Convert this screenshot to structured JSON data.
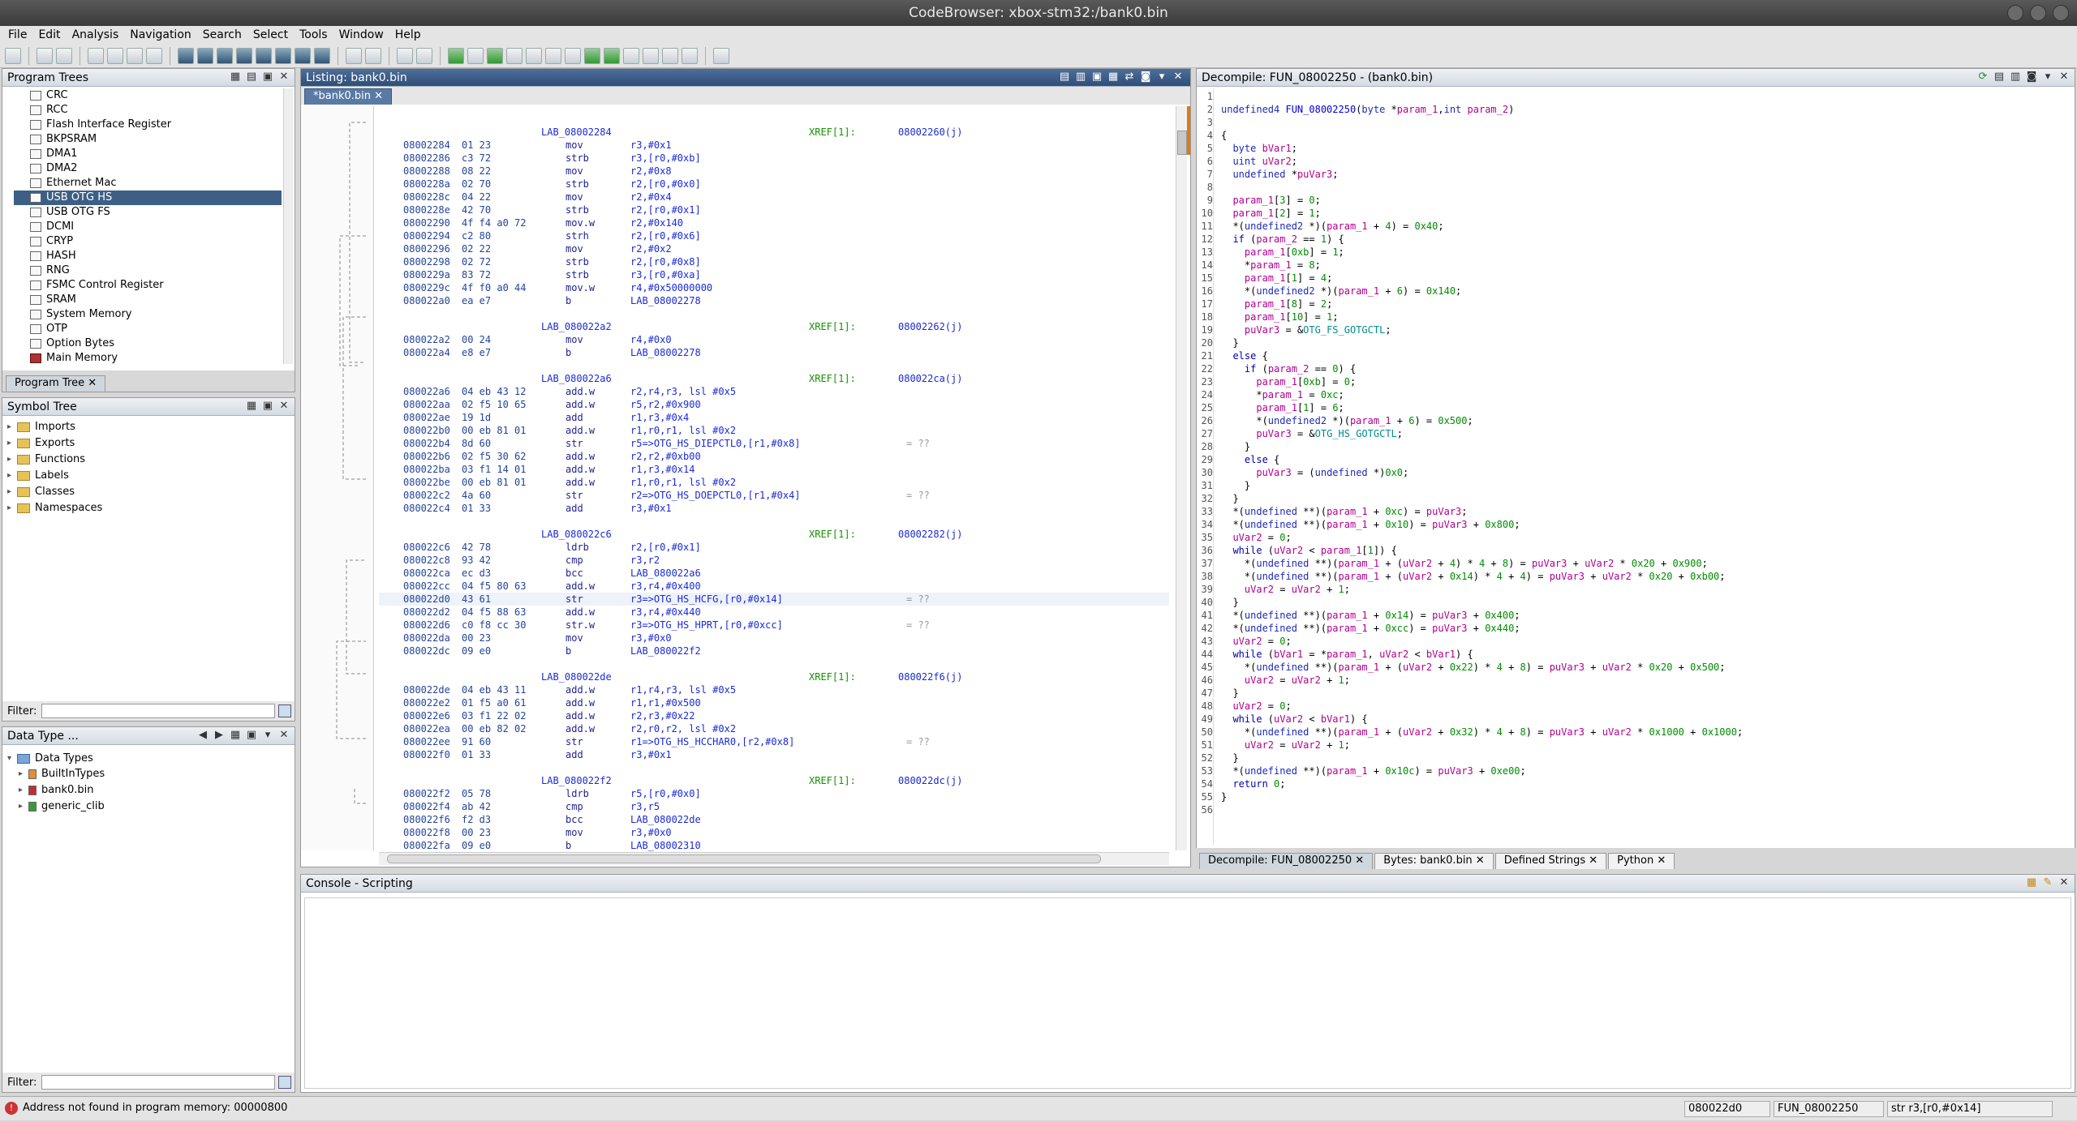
{
  "window": {
    "title": "CodeBrowser: xbox-stm32:/bank0.bin"
  },
  "menu": [
    "File",
    "Edit",
    "Analysis",
    "Navigation",
    "Search",
    "Select",
    "Tools",
    "Window",
    "Help"
  ],
  "program_trees": {
    "title": "Program Trees",
    "items": [
      "CRC",
      "RCC",
      "Flash Interface Register",
      "BKPSRAM",
      "DMA1",
      "DMA2",
      "Ethernet Mac",
      "USB OTG HS",
      "USB OTG FS",
      "DCMI",
      "CRYP",
      "HASH",
      "RNG",
      "FSMC Control Register",
      "SRAM",
      "System Memory",
      "OTP",
      "Option Bytes",
      "Main Memory"
    ],
    "selected": "USB OTG HS",
    "tab": "Program Tree"
  },
  "symbol_tree": {
    "title": "Symbol Tree",
    "items": [
      "Imports",
      "Exports",
      "Functions",
      "Labels",
      "Classes",
      "Namespaces"
    ],
    "filter_label": "Filter:"
  },
  "data_types": {
    "title": "Data Type ...",
    "root": "Data Types",
    "items": [
      "BuiltInTypes",
      "bank0.bin",
      "generic_clib"
    ],
    "filter_label": "Filter:"
  },
  "listing": {
    "title": "Listing:  bank0.bin",
    "tab": "*bank0.bin",
    "rows": [
      {
        "k": "lab",
        "text": "LAB_08002284",
        "xref": "XREF[1]:",
        "xa": "08002260(j)"
      },
      {
        "a": "08002284",
        "b": "01 23",
        "m": "mov",
        "o": "r3,#0x1"
      },
      {
        "a": "08002286",
        "b": "c3 72",
        "m": "strb",
        "o": "r3,[r0,#0xb]"
      },
      {
        "a": "08002288",
        "b": "08 22",
        "m": "mov",
        "o": "r2,#0x8"
      },
      {
        "a": "0800228a",
        "b": "02 70",
        "m": "strb",
        "o": "r2,[r0,#0x0]"
      },
      {
        "a": "0800228c",
        "b": "04 22",
        "m": "mov",
        "o": "r2,#0x4"
      },
      {
        "a": "0800228e",
        "b": "42 70",
        "m": "strb",
        "o": "r2,[r0,#0x1]"
      },
      {
        "a": "08002290",
        "b": "4f f4 a0 72",
        "m": "mov.w",
        "o": "r2,#0x140"
      },
      {
        "a": "08002294",
        "b": "c2 80",
        "m": "strh",
        "o": "r2,[r0,#0x6]"
      },
      {
        "a": "08002296",
        "b": "02 22",
        "m": "mov",
        "o": "r2,#0x2"
      },
      {
        "a": "08002298",
        "b": "02 72",
        "m": "strb",
        "o": "r2,[r0,#0x8]"
      },
      {
        "a": "0800229a",
        "b": "83 72",
        "m": "strb",
        "o": "r3,[r0,#0xa]"
      },
      {
        "a": "0800229c",
        "b": "4f f0 a0 44",
        "m": "mov.w",
        "o": "r4,#0x50000000"
      },
      {
        "a": "080022a0",
        "b": "ea e7",
        "m": "b",
        "o": "LAB_08002278"
      },
      {
        "k": "blank"
      },
      {
        "k": "lab",
        "text": "LAB_080022a2",
        "xref": "XREF[1]:",
        "xa": "08002262(j)"
      },
      {
        "a": "080022a2",
        "b": "00 24",
        "m": "mov",
        "o": "r4,#0x0"
      },
      {
        "a": "080022a4",
        "b": "e8 e7",
        "m": "b",
        "o": "LAB_08002278"
      },
      {
        "k": "blank"
      },
      {
        "k": "lab",
        "text": "LAB_080022a6",
        "xref": "XREF[1]:",
        "xa": "080022ca(j)"
      },
      {
        "a": "080022a6",
        "b": "04 eb 43 12",
        "m": "add.w",
        "o": "r2,r4,r3, lsl #0x5"
      },
      {
        "a": "080022aa",
        "b": "02 f5 10 65",
        "m": "add.w",
        "o": "r5,r2,#0x900"
      },
      {
        "a": "080022ae",
        "b": "19 1d",
        "m": "add",
        "o": "r1,r3,#0x4"
      },
      {
        "a": "080022b0",
        "b": "00 eb 81 01",
        "m": "add.w",
        "o": "r1,r0,r1, lsl #0x2"
      },
      {
        "a": "080022b4",
        "b": "8d 60",
        "m": "str",
        "o": "r5=>OTG_HS_DIEPCTL0,[r1,#0x8]",
        "c": "= ??"
      },
      {
        "a": "080022b6",
        "b": "02 f5 30 62",
        "m": "add.w",
        "o": "r2,r2,#0xb00"
      },
      {
        "a": "080022ba",
        "b": "03 f1 14 01",
        "m": "add.w",
        "o": "r1,r3,#0x14"
      },
      {
        "a": "080022be",
        "b": "00 eb 81 01",
        "m": "add.w",
        "o": "r1,r0,r1, lsl #0x2"
      },
      {
        "a": "080022c2",
        "b": "4a 60",
        "m": "str",
        "o": "r2=>OTG_HS_DOEPCTL0,[r1,#0x4]",
        "c": "= ??"
      },
      {
        "a": "080022c4",
        "b": "01 33",
        "m": "add",
        "o": "r3,#0x1"
      },
      {
        "k": "blank"
      },
      {
        "k": "lab",
        "text": "LAB_080022c6",
        "xref": "XREF[1]:",
        "xa": "08002282(j)"
      },
      {
        "a": "080022c6",
        "b": "42 78",
        "m": "ldrb",
        "o": "r2,[r0,#0x1]"
      },
      {
        "a": "080022c8",
        "b": "93 42",
        "m": "cmp",
        "o": "r3,r2"
      },
      {
        "a": "080022ca",
        "b": "ec d3",
        "m": "bcc",
        "o": "LAB_080022a6"
      },
      {
        "a": "080022cc",
        "b": "04 f5 80 63",
        "m": "add.w",
        "o": "r3,r4,#0x400"
      },
      {
        "a": "080022d0",
        "b": "43 61",
        "m": "str",
        "o": "r3=>OTG_HS_HCFG,[r0,#0x14]",
        "c": "= ??",
        "hl": true
      },
      {
        "a": "080022d2",
        "b": "04 f5 88 63",
        "m": "add.w",
        "o": "r3,r4,#0x440"
      },
      {
        "a": "080022d6",
        "b": "c0 f8 cc 30",
        "m": "str.w",
        "o": "r3=>OTG_HS_HPRT,[r0,#0xcc]",
        "c": "= ??"
      },
      {
        "a": "080022da",
        "b": "00 23",
        "m": "mov",
        "o": "r3,#0x0"
      },
      {
        "a": "080022dc",
        "b": "09 e0",
        "m": "b",
        "o": "LAB_080022f2"
      },
      {
        "k": "blank"
      },
      {
        "k": "lab",
        "text": "LAB_080022de",
        "xref": "XREF[1]:",
        "xa": "080022f6(j)"
      },
      {
        "a": "080022de",
        "b": "04 eb 43 11",
        "m": "add.w",
        "o": "r1,r4,r3, lsl #0x5"
      },
      {
        "a": "080022e2",
        "b": "01 f5 a0 61",
        "m": "add.w",
        "o": "r1,r1,#0x500"
      },
      {
        "a": "080022e6",
        "b": "03 f1 22 02",
        "m": "add.w",
        "o": "r2,r3,#0x22"
      },
      {
        "a": "080022ea",
        "b": "00 eb 82 02",
        "m": "add.w",
        "o": "r2,r0,r2, lsl #0x2"
      },
      {
        "a": "080022ee",
        "b": "91 60",
        "m": "str",
        "o": "r1=>OTG_HS_HCCHAR0,[r2,#0x8]",
        "c": "= ??"
      },
      {
        "a": "080022f0",
        "b": "01 33",
        "m": "add",
        "o": "r3,#0x1"
      },
      {
        "k": "blank"
      },
      {
        "k": "lab",
        "text": "LAB_080022f2",
        "xref": "XREF[1]:",
        "xa": "080022dc(j)"
      },
      {
        "a": "080022f2",
        "b": "05 78",
        "m": "ldrb",
        "o": "r5,[r0,#0x0]"
      },
      {
        "a": "080022f4",
        "b": "ab 42",
        "m": "cmp",
        "o": "r3,r5"
      },
      {
        "a": "080022f6",
        "b": "f2 d3",
        "m": "bcc",
        "o": "LAB_080022de"
      },
      {
        "a": "080022f8",
        "b": "00 23",
        "m": "mov",
        "o": "r3,#0x0"
      },
      {
        "a": "080022fa",
        "b": "09 e0",
        "m": "b",
        "o": "LAB_08002310"
      }
    ]
  },
  "decompile": {
    "title": "Decompile: FUN_08002250 -  (bank0.bin)",
    "lines": [
      "",
      "undefined4 FUN_08002250(byte *param_1,int param_2)",
      "",
      "{",
      "  byte bVar1;",
      "  uint uVar2;",
      "  undefined *puVar3;",
      "  ",
      "  param_1[3] = 0;",
      "  param_1[2] = 1;",
      "  *(undefined2 *)(param_1 + 4) = 0x40;",
      "  if (param_2 == 1) {",
      "    param_1[0xb] = 1;",
      "    *param_1 = 8;",
      "    param_1[1] = 4;",
      "    *(undefined2 *)(param_1 + 6) = 0x140;",
      "    param_1[8] = 2;",
      "    param_1[10] = 1;",
      "    puVar3 = &OTG_FS_GOTGCTL;",
      "  }",
      "  else {",
      "    if (param_2 == 0) {",
      "      param_1[0xb] = 0;",
      "      *param_1 = 0xc;",
      "      param_1[1] = 6;",
      "      *(undefined2 *)(param_1 + 6) = 0x500;",
      "      puVar3 = &OTG_HS_GOTGCTL;",
      "    }",
      "    else {",
      "      puVar3 = (undefined *)0x0;",
      "    }",
      "  }",
      "  *(undefined **)(param_1 + 0xc) = puVar3;",
      "  *(undefined **)(param_1 + 0x10) = puVar3 + 0x800;",
      "  uVar2 = 0;",
      "  while (uVar2 < param_1[1]) {",
      "    *(undefined **)(param_1 + (uVar2 + 4) * 4 + 8) = puVar3 + uVar2 * 0x20 + 0x900;",
      "    *(undefined **)(param_1 + (uVar2 + 0x14) * 4 + 4) = puVar3 + uVar2 * 0x20 + 0xb00;",
      "    uVar2 = uVar2 + 1;",
      "  }",
      "  *(undefined **)(param_1 + 0x14) = puVar3 + 0x400;",
      "  *(undefined **)(param_1 + 0xcc) = puVar3 + 0x440;",
      "  uVar2 = 0;",
      "  while (bVar1 = *param_1, uVar2 < bVar1) {",
      "    *(undefined **)(param_1 + (uVar2 + 0x22) * 4 + 8) = puVar3 + uVar2 * 0x20 + 0x500;",
      "    uVar2 = uVar2 + 1;",
      "  }",
      "  uVar2 = 0;",
      "  while (uVar2 < bVar1) {",
      "    *(undefined **)(param_1 + (uVar2 + 0x32) * 4 + 8) = puVar3 + uVar2 * 0x1000 + 0x1000;",
      "    uVar2 = uVar2 + 1;",
      "  }",
      "  *(undefined **)(param_1 + 0x10c) = puVar3 + 0xe00;",
      "  return 0;",
      "}",
      ""
    ]
  },
  "bottom_tabs": [
    "Decompile: FUN_08002250",
    "Bytes: bank0.bin",
    "Defined Strings",
    "Python"
  ],
  "console": {
    "title": "Console - Scripting"
  },
  "status": {
    "message": "Address not found in program memory: 00000800",
    "address": "080022d0",
    "function": "FUN_08002250",
    "instruction": "str r3,[r0,#0x14]"
  }
}
